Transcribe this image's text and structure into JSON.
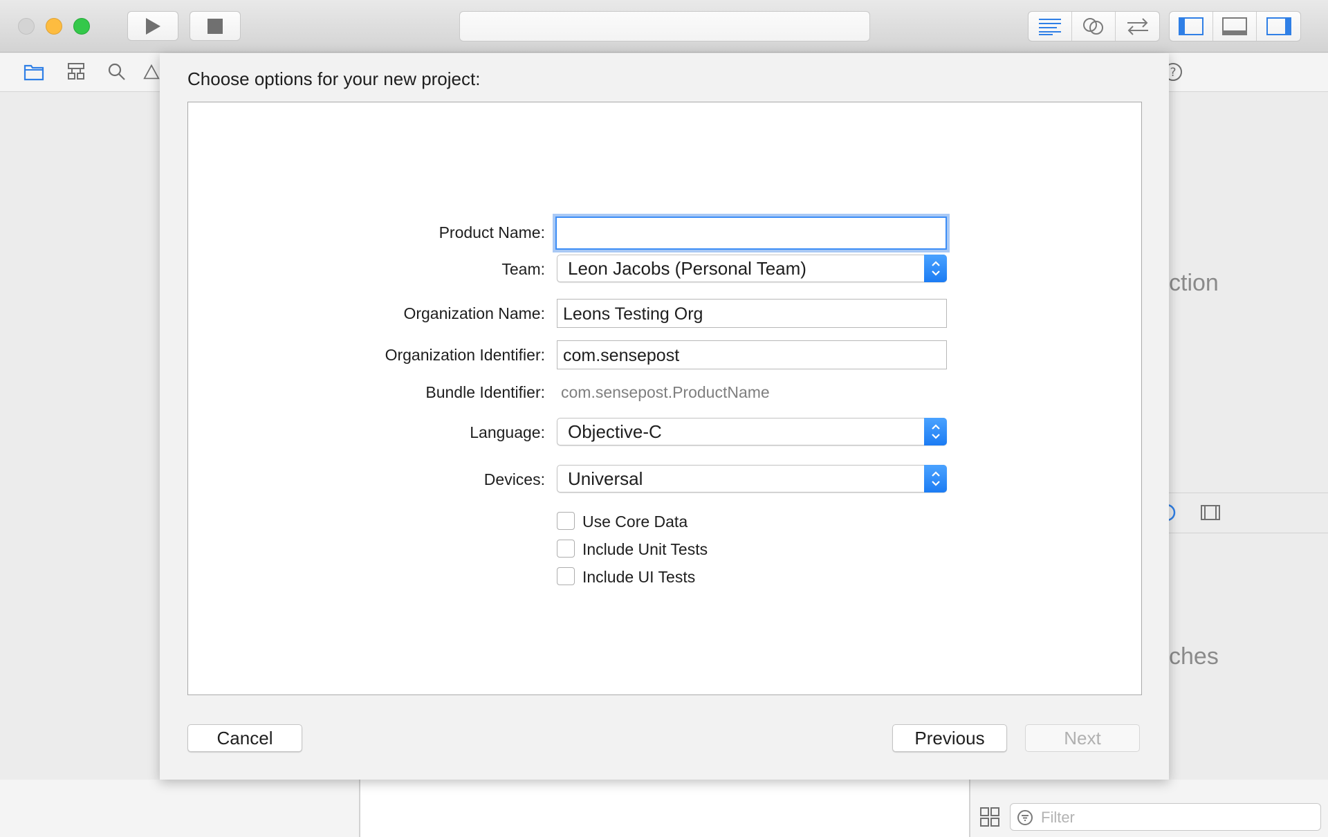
{
  "window": {
    "activity_text": ""
  },
  "background": {
    "right_text_top": "ction",
    "right_text_bottom": "ches",
    "filter_placeholder": "Filter"
  },
  "sheet": {
    "title": "Choose options for your new project:",
    "form": {
      "product_name": {
        "label": "Product Name:",
        "value": ""
      },
      "team": {
        "label": "Team:",
        "value": "Leon Jacobs (Personal Team)"
      },
      "organization_name": {
        "label": "Organization Name:",
        "value": "Leons Testing Org"
      },
      "organization_identifier": {
        "label": "Organization Identifier:",
        "value": "com.sensepost"
      },
      "bundle_identifier": {
        "label": "Bundle Identifier:",
        "value": "com.sensepost.ProductName"
      },
      "language": {
        "label": "Language:",
        "value": "Objective-C"
      },
      "devices": {
        "label": "Devices:",
        "value": "Universal"
      },
      "checkboxes": [
        {
          "label": "Use Core Data",
          "checked": false
        },
        {
          "label": "Include Unit Tests",
          "checked": false
        },
        {
          "label": "Include UI Tests",
          "checked": false
        }
      ]
    },
    "buttons": {
      "cancel": "Cancel",
      "previous": "Previous",
      "next": "Next"
    }
  },
  "colors": {
    "accent": "#1c7cf3",
    "focus_ring": "#a9c9f5",
    "traffic_close": "#d4d4d4",
    "traffic_minimize": "#fdbc40",
    "traffic_maximize": "#34c84a"
  },
  "icons": [
    "run-icon",
    "stop-icon",
    "standard-editor-icon",
    "assistant-editor-icon",
    "version-editor-icon",
    "navigator-toggle-icon",
    "debug-area-toggle-icon",
    "utilities-toggle-icon",
    "project-navigator-icon",
    "symbol-navigator-icon",
    "find-navigator-icon",
    "issue-navigator-icon",
    "help-icon",
    "grid-icon",
    "filter-icon"
  ]
}
